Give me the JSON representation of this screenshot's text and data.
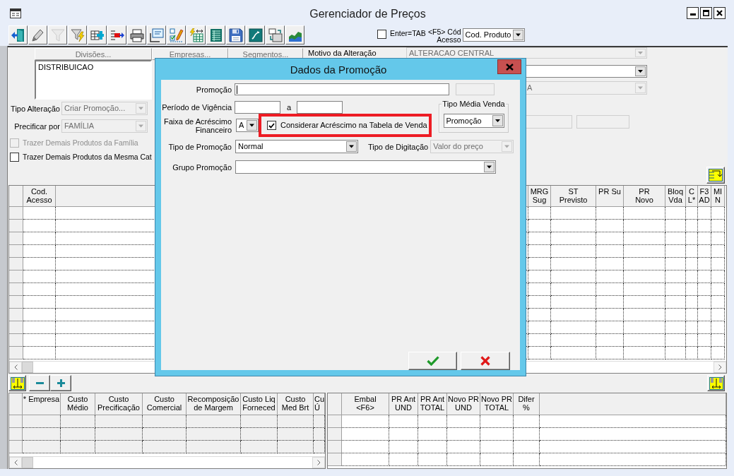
{
  "window": {
    "title": "Gerenciador de Preços"
  },
  "toolbar": {
    "buttons": [
      {
        "kind": "exit",
        "disabled": false
      },
      {
        "kind": "pencil",
        "disabled": false
      },
      {
        "kind": "filter",
        "disabled": true
      },
      {
        "kind": "filter_flash",
        "disabled": false
      },
      {
        "kind": "insert",
        "disabled": false
      },
      {
        "kind": "export",
        "disabled": false
      },
      {
        "kind": "print",
        "disabled": false
      },
      {
        "kind": "form",
        "disabled": false
      },
      {
        "kind": "checklist",
        "disabled": false
      },
      {
        "kind": "grid_flash",
        "disabled": false
      },
      {
        "kind": "sheet",
        "disabled": false
      },
      {
        "kind": "save",
        "disabled": false
      },
      {
        "kind": "link",
        "disabled": false
      },
      {
        "kind": "swap",
        "disabled": false
      },
      {
        "kind": "chart",
        "disabled": false
      }
    ],
    "enter_tab": {
      "label": "Enter=TAB",
      "checked": false
    },
    "access_field": {
      "label_lines": [
        "<F5> Cód",
        "Acesso"
      ],
      "value": "Cod. Produto"
    }
  },
  "filters": {
    "selector_buttons": [
      {
        "label": "Divisões...",
        "disabled": true
      },
      {
        "label": "Empresas...",
        "disabled": true
      },
      {
        "label": "Segmentos...",
        "disabled": true
      }
    ],
    "divisions_list": [
      "DISTRIBUICAO"
    ],
    "tipo_alteracao": {
      "label": "Tipo Alteração",
      "value": "Criar Promoção...",
      "disabled": true
    },
    "precificar_por": {
      "label": "Precificar por",
      "value": "FAMÍLIA",
      "disabled": true
    },
    "checkboxes": [
      {
        "label": "Trazer Demais Produtos da Família",
        "checked": false,
        "disabled": true
      },
      {
        "label": "Trazer Demais Produtos da Mesma Cat",
        "checked": false,
        "disabled": false
      }
    ],
    "motivo": {
      "label": "Motivo da Alteração",
      "value": "ALTERACAO CENTRAL",
      "disabled": true
    },
    "dropdown_2": {
      "disabled": false
    },
    "dropdown_3": {
      "value": "A",
      "disabled": true
    },
    "text_fields": [
      {
        "disabled": true
      },
      {
        "disabled": true
      }
    ]
  },
  "main_grid": {
    "columns": [
      {
        "header": [
          "Cod.",
          "Acesso"
        ]
      },
      {
        "header": [
          "MRG",
          "Sug"
        ]
      },
      {
        "header": [
          "ST",
          "Previsto"
        ]
      },
      {
        "header": [
          "PR Su"
        ]
      },
      {
        "header": [
          "PR",
          "Novo"
        ]
      },
      {
        "header": [
          "Bloq",
          "Vda"
        ]
      },
      {
        "header": [
          "C",
          "L*"
        ]
      },
      {
        "header": [
          "F3",
          "AD"
        ]
      },
      {
        "header": [
          "MI",
          "N"
        ]
      }
    ]
  },
  "bottom_toolbar": {
    "buttons": [
      {
        "kind": "columns"
      },
      {
        "kind": "minus"
      },
      {
        "kind": "plus"
      }
    ],
    "right_button": {
      "kind": "columns"
    }
  },
  "cost_grid": {
    "disabled": true,
    "columns": [
      {
        "header": [
          "* Empresa"
        ]
      },
      {
        "header": [
          "Custo",
          "Médio"
        ]
      },
      {
        "header": [
          "Custo",
          "Precificação"
        ]
      },
      {
        "header": [
          "Custo",
          "Comercial"
        ]
      },
      {
        "header": [
          "Recomposição",
          "de Margem"
        ]
      },
      {
        "header": [
          "Custo Liq",
          "Forneced"
        ]
      },
      {
        "header": [
          "Custo",
          "Med Brt"
        ]
      },
      {
        "header": [
          "Cu",
          "Ú"
        ]
      }
    ]
  },
  "price_grid": {
    "disabled": false,
    "columns": [
      {
        "header": [
          "Embal",
          "<F6>"
        ]
      },
      {
        "header": [
          "PR Ant",
          "UND"
        ]
      },
      {
        "header": [
          "PR Ant",
          "TOTAL"
        ]
      },
      {
        "header": [
          "Novo PR",
          "UND"
        ]
      },
      {
        "header": [
          "Novo PR",
          "TOTAL"
        ]
      },
      {
        "header": [
          "Difer",
          "%"
        ]
      }
    ]
  },
  "dialog": {
    "title": "Dados da Promoção",
    "promocao": {
      "label": "Promoção",
      "focused": true,
      "code_field_disabled": true
    },
    "periodo": {
      "label": "Período de Vigência",
      "separator": "a"
    },
    "faixa": {
      "label_lines": [
        "Faixa de Acréscimo",
        "Financeiro"
      ],
      "value": "A"
    },
    "considerar": {
      "label": "Considerar Acréscimo na Tabela de Venda",
      "checked": true,
      "highlighted": true
    },
    "tipo_media_venda": {
      "legend": "Tipo Média Venda",
      "value": "Promoção"
    },
    "tipo_promocao": {
      "label": "Tipo de Promoção",
      "value": "Normal"
    },
    "tipo_digitacao": {
      "label": "Tipo de Digitação",
      "value": "Valor do preço",
      "disabled": true
    },
    "grupo_promocao": {
      "label": "Grupo Promoção"
    },
    "buttons": [
      {
        "kind": "confirm"
      },
      {
        "kind": "cancel"
      }
    ]
  }
}
